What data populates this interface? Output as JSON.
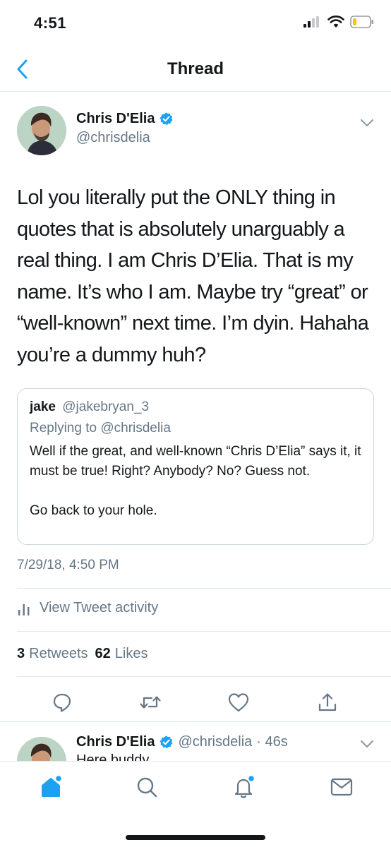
{
  "status_bar": {
    "time": "4:51"
  },
  "nav": {
    "title": "Thread"
  },
  "tweet": {
    "author": {
      "name": "Chris D'Elia",
      "handle": "@chrisdelia",
      "verified": true
    },
    "text": "Lol you literally put the ONLY thing in quotes that is absolutely unarguably a real thing. I am Chris D’Elia. That is my name. It’s who I am. Maybe try “great” or “well-known” next time. I’m dyin. Hahaha you’re a dummy huh?",
    "quoted": {
      "name": "jake",
      "handle": "@jakebryan_3",
      "replying_to": "Replying to @chrisdelia",
      "body_line1": "Well if the great, and well-known “Chris D’Elia” says it, it must be true! Right? Anybody? No? Guess not.",
      "body_line2": "Go back to your hole."
    },
    "timestamp": "7/29/18, 4:50 PM",
    "activity_label": "View Tweet activity",
    "retweets_count": "3",
    "retweets_label": "Retweets",
    "likes_count": "62",
    "likes_label": "Likes"
  },
  "reply": {
    "name": "Chris D'Elia",
    "handle": "@chrisdelia",
    "time": "· 46s",
    "text": "Here buddy"
  },
  "colors": {
    "accent": "#1da1f2",
    "secondary_text": "#657786",
    "border": "#e1e8ed",
    "primary_text": "#14171a"
  },
  "icons": {
    "back": "chevron-left-icon",
    "verified": "verified-badge-icon",
    "more": "chevron-down-icon",
    "activity": "bar-chart-icon",
    "reply": "reply-icon",
    "retweet": "retweet-icon",
    "like": "heart-icon",
    "share": "share-icon",
    "tabs": [
      "home-icon",
      "search-icon",
      "notifications-icon",
      "messages-icon"
    ]
  }
}
